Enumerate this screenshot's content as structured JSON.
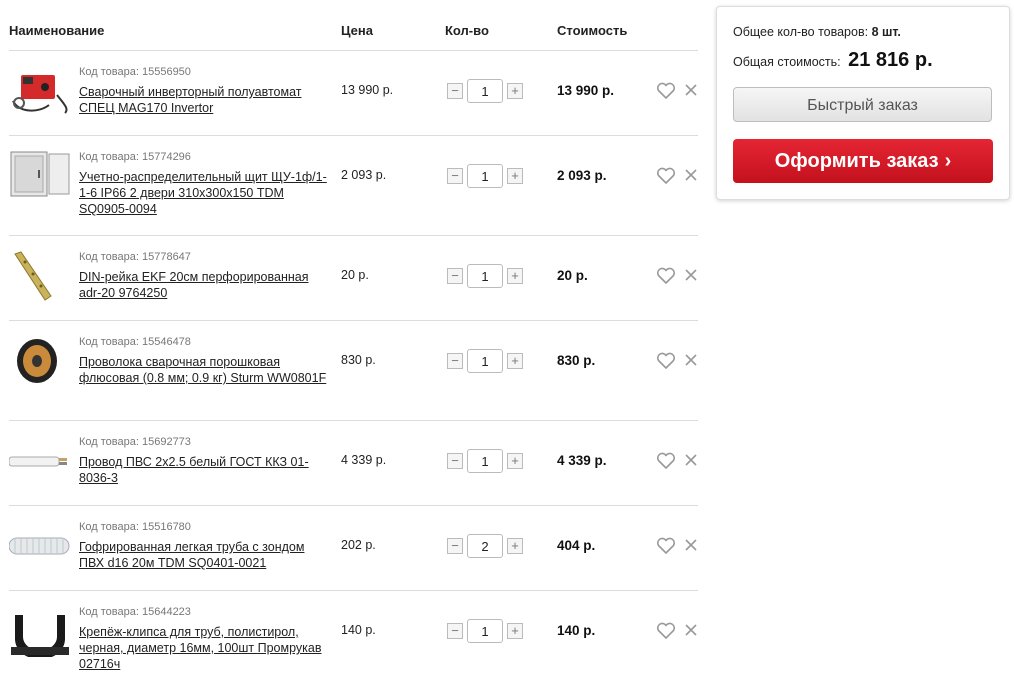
{
  "headers": {
    "name": "Наименование",
    "price": "Цена",
    "qty": "Кол-во",
    "cost": "Стоимость"
  },
  "items": [
    {
      "code": "Код товара: 15556950",
      "title": "Сварочный инверторный полуавтомат СПЕЦ MAG170 Invertor",
      "price": "13 990 р.",
      "qty": "1",
      "cost": "13 990 р.",
      "thumb": "welding-machine-image"
    },
    {
      "code": "Код товара: 15774296",
      "title": "Учетно-распределительный щит ЩУ-1ф/1-1-6 IP66 2 двери 310х300х150 TDM SQ0905-0094",
      "price": "2 093 р.",
      "qty": "1",
      "cost": "2 093 р.",
      "thumb": "distribution-box-image"
    },
    {
      "code": "Код товара: 15778647",
      "title": "DIN-рейка EKF 20см перфорированная adr-20 9764250",
      "price": "20 р.",
      "qty": "1",
      "cost": "20 р.",
      "thumb": "din-rail-image"
    },
    {
      "code": "Код товара: 15546478",
      "title": "Проволока сварочная порошковая флюсовая (0.8 мм; 0.9 кг) Sturm WW0801F",
      "price": "830 р.",
      "qty": "1",
      "cost": "830 р.",
      "thumb": "wire-spool-image"
    },
    {
      "code": "Код товара: 15692773",
      "title": "Провод ПВС 2х2.5 белый ГОСТ ККЗ 01-8036-3",
      "price": "4 339 р.",
      "qty": "1",
      "cost": "4 339 р.",
      "thumb": "cable-image"
    },
    {
      "code": "Код товара: 15516780",
      "title": "Гофрированная легкая труба с зондом ПВХ d16 20м TDM SQ0401-0021",
      "price": "202 р.",
      "qty": "2",
      "cost": "404 р.",
      "thumb": "corrugated-pipe-image"
    },
    {
      "code": "Код товара: 15644223",
      "title": "Крепёж-клипса для труб, полистирол, черная, диаметр 16мм, 100шт Промрукав 02716ч",
      "price": "140 р.",
      "qty": "1",
      "cost": "140 р.",
      "thumb": "pipe-clip-image"
    }
  ],
  "summary": {
    "count_label": "Общее кол-во товаров:",
    "count_value": "8 шт.",
    "total_label": "Общая стоимость:",
    "total_value": "21 816 р.",
    "quick_order": "Быстрый заказ",
    "checkout": "Оформить заказ",
    "checkout_chevron": "›"
  },
  "controls": {
    "minus": "−",
    "plus": "+"
  },
  "colors": {
    "accent": "#d81b28",
    "divider": "#dcdcdc",
    "muted_text": "#777777"
  }
}
